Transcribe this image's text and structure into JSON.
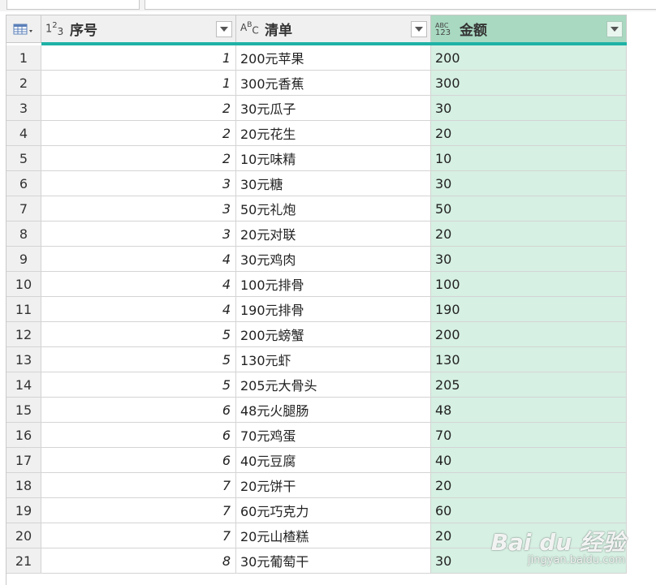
{
  "table": {
    "columns": [
      {
        "name": "序号",
        "type_icon": "number-type-icon",
        "type_text": [
          "1",
          "2",
          "3"
        ]
      },
      {
        "name": "清单",
        "type_icon": "text-type-icon",
        "type_text": [
          "A",
          "B",
          "C"
        ]
      },
      {
        "name": "金额",
        "type_icon": "any-type-icon",
        "type_text": [
          "ABC",
          "123"
        ],
        "selected": true
      }
    ],
    "rows": [
      [
        "1",
        "1",
        "200元苹果",
        "200"
      ],
      [
        "2",
        "1",
        "300元香蕉",
        "300"
      ],
      [
        "3",
        "2",
        "30元瓜子",
        "30"
      ],
      [
        "4",
        "2",
        "20元花生",
        "20"
      ],
      [
        "5",
        "2",
        "10元味精",
        "10"
      ],
      [
        "6",
        "3",
        "30元糖",
        "30"
      ],
      [
        "7",
        "3",
        "50元礼炮",
        "50"
      ],
      [
        "8",
        "3",
        "20元对联",
        "20"
      ],
      [
        "9",
        "4",
        "30元鸡肉",
        "30"
      ],
      [
        "10",
        "4",
        "100元排骨",
        "100"
      ],
      [
        "11",
        "4",
        "190元排骨",
        "190"
      ],
      [
        "12",
        "5",
        "200元螃蟹",
        "200"
      ],
      [
        "13",
        "5",
        "130元虾",
        "130"
      ],
      [
        "14",
        "5",
        "205元大骨头",
        "205"
      ],
      [
        "15",
        "6",
        "48元火腿肠",
        "48"
      ],
      [
        "16",
        "6",
        "70元鸡蛋",
        "70"
      ],
      [
        "17",
        "6",
        "40元豆腐",
        "40"
      ],
      [
        "18",
        "7",
        "20元饼干",
        "20"
      ],
      [
        "19",
        "7",
        "60元巧克力",
        "60"
      ],
      [
        "20",
        "7",
        "20元山楂糕",
        "20"
      ],
      [
        "21",
        "8",
        "30元葡萄干",
        "30"
      ]
    ]
  },
  "colors": {
    "quality_bar": "#1fb2a6",
    "selected_header": "#a9d9c1",
    "selected_cells": "#d6f0e3"
  },
  "watermark": {
    "brand": "Bai du 经验",
    "url": "jingyan.baidu.com"
  }
}
